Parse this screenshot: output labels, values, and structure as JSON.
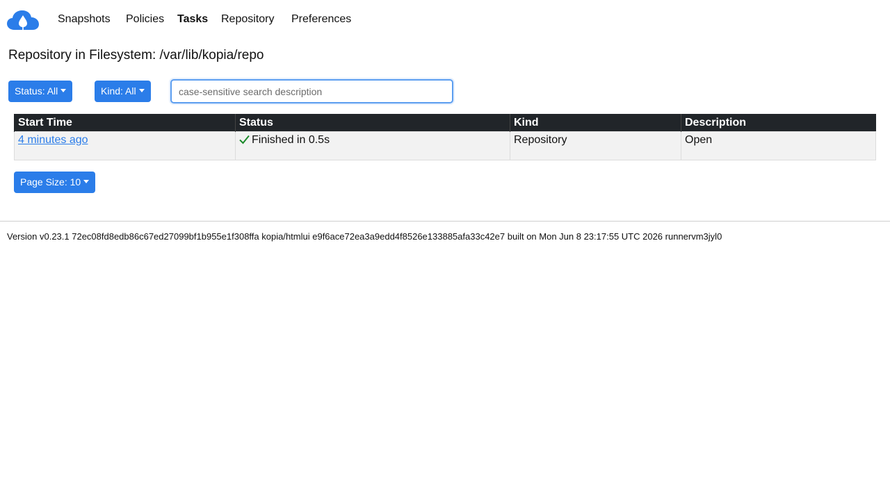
{
  "nav": {
    "logo": "kopia-cloud-logo-icon",
    "links": [
      {
        "label": "Snapshots",
        "active": false
      },
      {
        "label": "Policies",
        "active": false
      },
      {
        "label": "Tasks",
        "active": true
      },
      {
        "label": "Repository",
        "active": false
      },
      {
        "label": "Preferences",
        "active": false
      }
    ]
  },
  "page": {
    "title": "Repository in Filesystem: /var/lib/kopia/repo"
  },
  "filters": {
    "status_label": "Status: All",
    "kind_label": "Kind: All",
    "search_placeholder": "case-sensitive search description",
    "search_value": ""
  },
  "table": {
    "headers": [
      "Start Time",
      "Status",
      "Kind",
      "Description"
    ],
    "rows": [
      {
        "start_time": "4 minutes ago",
        "status": "Finished in 0.5s",
        "status_icon": "check-icon",
        "kind": "Repository",
        "description": "Open"
      }
    ]
  },
  "pagination": {
    "page_size_label": "Page Size: 10"
  },
  "footer": {
    "version_text": "Version v0.23.1 72ec08fd8edb86c67ed27099bf1b955e1f308ffa kopia/htmlui e9f6ace72ea3a9edd4f8526e133885afa33c42e7 built on Mon Jun 8 23:17:55 UTC 2026 runnervm3jyl0"
  },
  "colors": {
    "accent": "#2b7de9",
    "table_header_bg": "#212529",
    "success": "#1a8a2a"
  }
}
